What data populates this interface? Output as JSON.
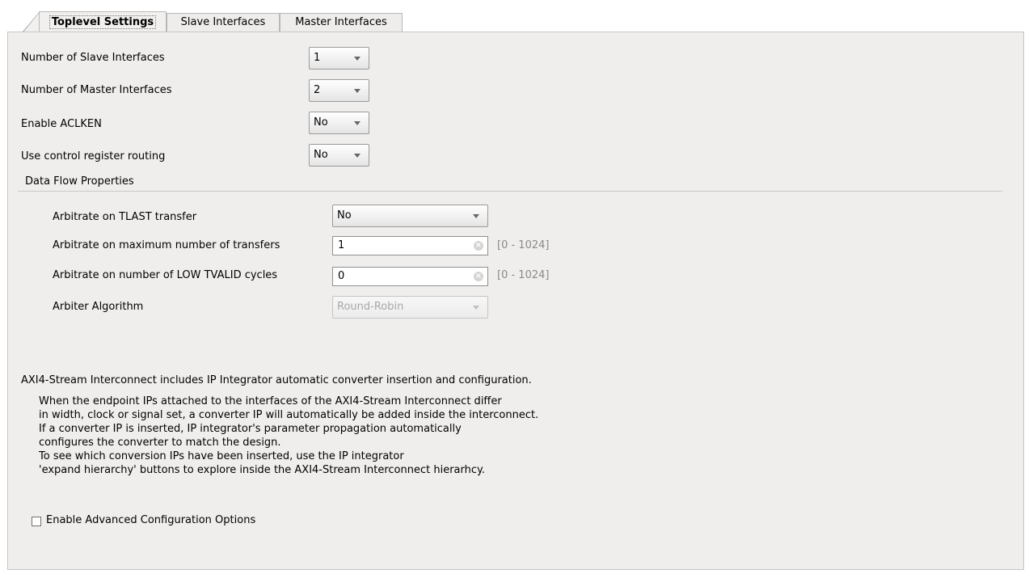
{
  "tabs": [
    {
      "label": "Toplevel Settings",
      "active": true
    },
    {
      "label": "Slave Interfaces",
      "active": false
    },
    {
      "label": "Master Interfaces",
      "active": false
    }
  ],
  "settings": {
    "num_slave": {
      "label": "Number of Slave Interfaces",
      "value": "1"
    },
    "num_master": {
      "label": "Number of Master Interfaces",
      "value": "2"
    },
    "aclken": {
      "label": "Enable ACLKEN",
      "value": "No"
    },
    "ctrl_routing": {
      "label": "Use control register routing",
      "value": "No"
    }
  },
  "data_flow": {
    "title": "Data Flow Properties",
    "tlast": {
      "label": "Arbitrate on TLAST transfer",
      "value": "No"
    },
    "max_transfers": {
      "label": "Arbitrate on maximum number of transfers",
      "value": "1",
      "range": "[0 - 1024]"
    },
    "low_tvalid": {
      "label": "Arbitrate on number of LOW TVALID cycles",
      "value": "0",
      "range": "[0 - 1024]"
    },
    "algorithm": {
      "label": "Arbiter Algorithm",
      "value": "Round-Robin"
    }
  },
  "info": {
    "heading": "AXI4-Stream Interconnect includes IP Integrator automatic converter insertion and configuration.",
    "lines": [
      "When the endpoint IPs attached to the interfaces of the AXI4-Stream Interconnect differ",
      "in width, clock or signal set, a converter IP will automatically be added inside the interconnect.",
      "If a converter IP is inserted, IP integrator's parameter propagation automatically",
      "configures the converter to match the design.",
      "To see which conversion IPs have been inserted, use the IP integrator",
      "'expand hierarchy' buttons to explore inside the AXI4-Stream Interconnect hierarhcy."
    ]
  },
  "advanced": {
    "label": "Enable Advanced Configuration Options",
    "checked": false
  },
  "colors": {
    "panel_bg": "#efeeec",
    "range_text": "#8a8a8a"
  },
  "icons": {
    "dropdown": "chevron-down-icon",
    "clear": "clear-icon"
  }
}
